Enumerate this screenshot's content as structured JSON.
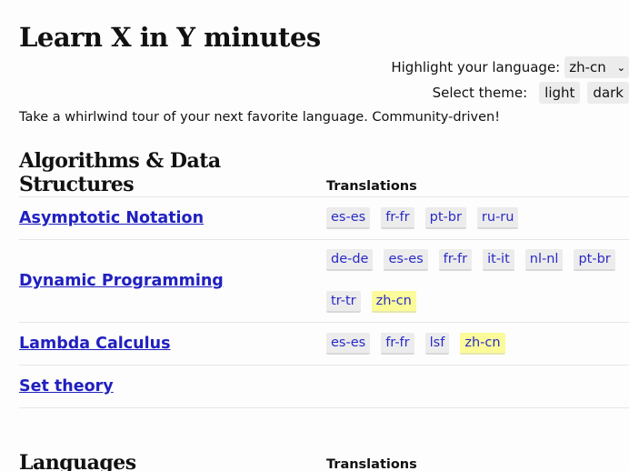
{
  "header": {
    "title": "Learn X in Y minutes",
    "highlight_label": "Highlight your language:",
    "highlight_value": "zh-cn",
    "theme_label": "Select theme:",
    "theme_light": "light",
    "theme_dark": "dark",
    "tagline": "Take a whirlwind tour of your next favorite language. Community-driven!"
  },
  "colors": {
    "link": "#2020c0",
    "tag_bg": "#ececec",
    "highlight_bg": "#fbfb9a"
  },
  "sections": [
    {
      "title": "Algorithms & Data Structures",
      "translations_label": "Translations",
      "rows": [
        {
          "name": "Asymptotic Notation",
          "tags": [
            {
              "label": "es-es",
              "highlight": false
            },
            {
              "label": "fr-fr",
              "highlight": false
            },
            {
              "label": "pt-br",
              "highlight": false
            },
            {
              "label": "ru-ru",
              "highlight": false
            }
          ]
        },
        {
          "name": "Dynamic Programming",
          "tags": [
            {
              "label": "de-de",
              "highlight": false
            },
            {
              "label": "es-es",
              "highlight": false
            },
            {
              "label": "fr-fr",
              "highlight": false
            },
            {
              "label": "it-it",
              "highlight": false
            },
            {
              "label": "nl-nl",
              "highlight": false
            },
            {
              "label": "pt-br",
              "highlight": false
            },
            {
              "label": "tr-tr",
              "highlight": false
            },
            {
              "label": "zh-cn",
              "highlight": true
            }
          ]
        },
        {
          "name": "Lambda Calculus",
          "tags": [
            {
              "label": "es-es",
              "highlight": false
            },
            {
              "label": "fr-fr",
              "highlight": false
            },
            {
              "label": "lsf",
              "highlight": false
            },
            {
              "label": "zh-cn",
              "highlight": true
            }
          ]
        },
        {
          "name": "Set theory",
          "tags": []
        }
      ]
    },
    {
      "title": "Languages",
      "translations_label": "Translations",
      "rows": []
    }
  ]
}
